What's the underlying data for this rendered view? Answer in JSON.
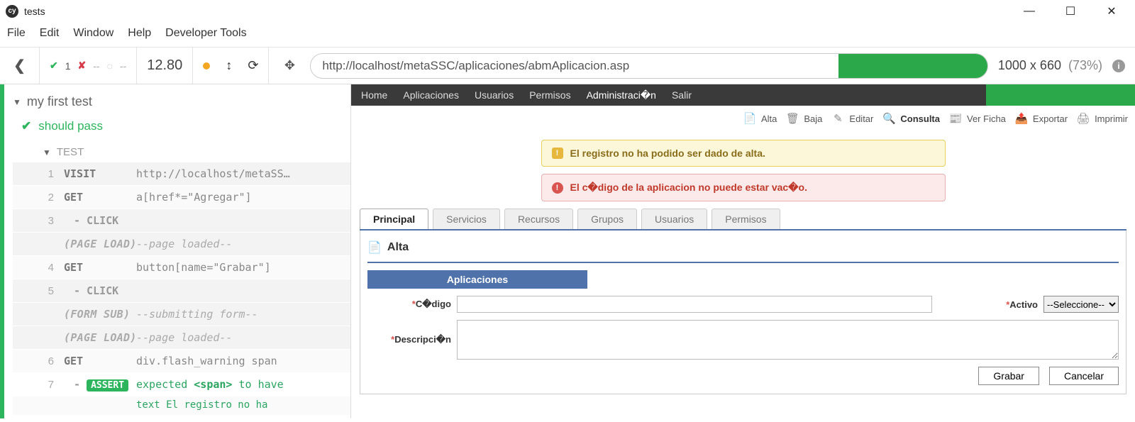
{
  "window": {
    "appIconText": "cy",
    "title": "tests"
  },
  "menu": {
    "items": [
      "File",
      "Edit",
      "Window",
      "Help",
      "Developer Tools"
    ]
  },
  "runner": {
    "passCount": "1",
    "failCount": "--",
    "pendingCount": "--",
    "time": "12.80",
    "url": "http://localhost/metaSSC/aplicaciones/abmAplicacion.asp",
    "viewport": "1000 x 660",
    "scale": "(73%)"
  },
  "spec": {
    "suite": "my first test",
    "test": "should pass",
    "bodyLabel": "TEST",
    "commands": [
      {
        "num": "1",
        "name": "VISIT",
        "msg": "http://localhost/metaSS…"
      },
      {
        "num": "2",
        "name": "GET",
        "msg": "a[href*=\"Agregar\"]"
      },
      {
        "num": "3",
        "name": "- CLICK",
        "child": true
      },
      {
        "event": "(PAGE LOAD)",
        "msg": "--page loaded--"
      },
      {
        "num": "4",
        "name": "GET",
        "msg": "button[name=\"Grabar\"]"
      },
      {
        "num": "5",
        "name": "- CLICK",
        "child": true
      },
      {
        "event": "(FORM SUB)",
        "msg": "--submitting form--"
      },
      {
        "event": "(PAGE LOAD)",
        "msg": "--page loaded--"
      },
      {
        "num": "6",
        "name": "GET",
        "msg": "div.flash_warning span"
      },
      {
        "num": "7",
        "assert": true,
        "prefix": "-",
        "badge": "ASSERT",
        "line1_pre": "expected ",
        "line1_tag": "<span>",
        "line1_post": " to have",
        "line2_pre": "text ",
        "line2_bold": "El registro no ha"
      }
    ]
  },
  "aut": {
    "nav": [
      "Home",
      "Aplicaciones",
      "Usuarios",
      "Permisos",
      "Administraci�n",
      "Salir"
    ],
    "toolbar": [
      {
        "icon": "plus-icon",
        "label": "Alta"
      },
      {
        "icon": "delete-icon",
        "label": "Baja"
      },
      {
        "icon": "edit-icon",
        "label": "Editar"
      },
      {
        "icon": "search-icon",
        "label": "Consulta",
        "bold": true
      },
      {
        "icon": "view-icon",
        "label": "Ver Ficha"
      },
      {
        "icon": "export-icon",
        "label": "Exportar"
      },
      {
        "icon": "print-icon",
        "label": "Imprimir"
      }
    ],
    "alerts": {
      "warn": "El registro no ha podido ser dado de alta.",
      "err": "El c�digo de la aplicacion no puede estar vac�o."
    },
    "tabs": [
      "Principal",
      "Servicios",
      "Recursos",
      "Grupos",
      "Usuarios",
      "Permisos"
    ],
    "panelTitle": "Alta",
    "formTitle": "Aplicaciones",
    "fields": {
      "codigoLabel": "C�digo",
      "activoLabel": "Activo",
      "activoSelected": "--Seleccione--",
      "descLabel": "Descripci�n"
    },
    "buttons": {
      "save": "Grabar",
      "cancel": "Cancelar"
    }
  }
}
